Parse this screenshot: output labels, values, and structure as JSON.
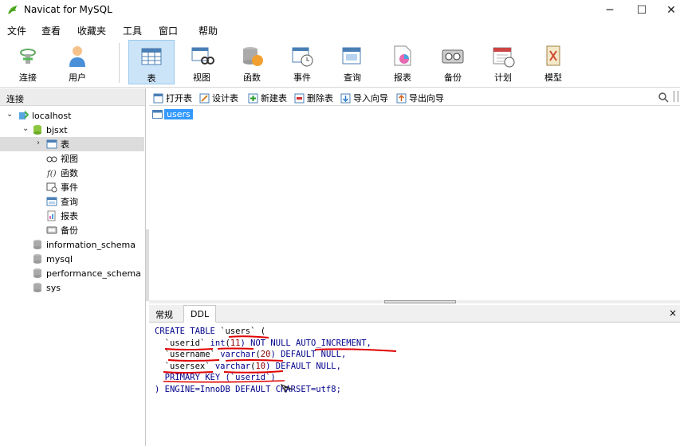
{
  "window": {
    "title": "Navicat for MySQL",
    "minimize": "─",
    "maximize": "☐",
    "close": "✕"
  },
  "menu": [
    "文件",
    "查看",
    "收藏夹",
    "工具",
    "窗口",
    "帮助"
  ],
  "toolbar": [
    {
      "label": "连接",
      "icon": "connection-icon"
    },
    {
      "label": "用户",
      "icon": "user-icon"
    },
    {
      "label": "表",
      "icon": "table-icon",
      "active": true
    },
    {
      "label": "视图",
      "icon": "view-icon"
    },
    {
      "label": "函数",
      "icon": "function-icon"
    },
    {
      "label": "事件",
      "icon": "event-icon"
    },
    {
      "label": "查询",
      "icon": "query-icon"
    },
    {
      "label": "报表",
      "icon": "report-icon"
    },
    {
      "label": "备份",
      "icon": "backup-icon"
    },
    {
      "label": "计划",
      "icon": "schedule-icon"
    },
    {
      "label": "模型",
      "icon": "model-icon"
    }
  ],
  "left_panel": {
    "header": "连接",
    "tree": [
      {
        "label": "localhost"
      },
      {
        "label": "bjsxt"
      },
      {
        "label": "表"
      },
      {
        "label": "视图"
      },
      {
        "label": "函数"
      },
      {
        "label": "事件"
      },
      {
        "label": "查询"
      },
      {
        "label": "报表"
      },
      {
        "label": "备份"
      },
      {
        "label": "information_schema"
      },
      {
        "label": "mysql"
      },
      {
        "label": "performance_schema"
      },
      {
        "label": "sys"
      }
    ]
  },
  "object_toolbar": [
    "打开表",
    "设计表",
    "新建表",
    "删除表",
    "导入向导",
    "导出向导"
  ],
  "tables": [
    "users"
  ],
  "tabs": [
    "常规",
    "DDL"
  ],
  "ddl": {
    "l1a": "CREATE TABLE ",
    "l1b": "`users`",
    "l1c": " (",
    "l2a": "  `userid` ",
    "l2b": "int",
    "l2c": "(",
    "l2d": "11",
    "l2e": ") NOT NULL AUTO_INCREMENT,",
    "l3a": "  `username` ",
    "l3b": "varchar",
    "l3c": "(",
    "l3d": "20",
    "l3e": ") DEFAULT NULL,",
    "l4a": "  `usersex` ",
    "l4b": "varchar",
    "l4c": "(",
    "l4d": "10",
    "l4e": ") DEFAULT NULL,",
    "l5": "  PRIMARY KEY (`userid`)",
    "l6": ") ENGINE=InnoDB DEFAULT CHARSET=utf8;"
  },
  "colors": {
    "accent": "#3399ff",
    "annotation": "#e00000",
    "keyword": "#00008b"
  }
}
